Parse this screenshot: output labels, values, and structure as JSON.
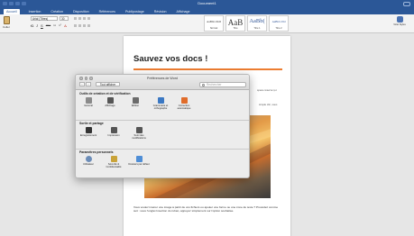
{
  "window": {
    "title": "Document1"
  },
  "ribbon_tabs": [
    "Accueil",
    "Insertion",
    "Création",
    "Disposition",
    "Références",
    "Publipostage",
    "Révision",
    "Affichage"
  ],
  "ribbon": {
    "paste_label": "Coller",
    "font_name": "Arial (Titres)",
    "font_size": "30",
    "format_buttons": [
      "G",
      "I",
      "S",
      "abc",
      "x₂",
      "x²",
      "A"
    ],
    "styles": [
      {
        "sample": "AaBbCcDdI",
        "name": "Normal"
      },
      {
        "sample": "AaB",
        "name": "Titre"
      },
      {
        "sample": "AaBb(",
        "name": "Titre 1"
      },
      {
        "sample": "AaBbCcDd",
        "name": "Titre 2"
      }
    ],
    "styles_pane_label": "Volet Styles"
  },
  "document": {
    "heading": "Sauvez vos docs !",
    "snippet_1": "space réservé (et",
    "snippet_2": "simple clic, sous",
    "paragraph": "Vous voulez insérer une image à partir de vos fichiers ou ajouter une forme ou une zone de texte ? Procédez comme suit : sous l'onglet Insertion du ruban, appuyez simplement sur l'option souhaitée."
  },
  "prefs_dialog": {
    "title": "Préférences de Word",
    "show_all": "Tout afficher",
    "search_placeholder": "Rechercher",
    "sections": [
      {
        "title": "Outils de création et de vérification",
        "items": [
          {
            "label": "Général",
            "icon": "general-icon",
            "color": "#8a8a8a"
          },
          {
            "label": "Affichage",
            "icon": "view-icon",
            "color": "#555555"
          },
          {
            "label": "Édition",
            "icon": "edit-icon",
            "color": "#6b6b6b"
          },
          {
            "label": "Grammaire et orthographe",
            "icon": "spelling-icon",
            "color": "#3b78c3"
          },
          {
            "label": "Correction automatique",
            "icon": "autocorrect-icon",
            "color": "#e06c2a"
          }
        ]
      },
      {
        "title": "Sortie et partage",
        "items": [
          {
            "label": "Enregistrement",
            "icon": "save-icon",
            "color": "#333333"
          },
          {
            "label": "Impression",
            "icon": "print-icon",
            "color": "#555555"
          },
          {
            "label": "Suivi des modifications",
            "icon": "track-changes-icon",
            "color": "#555555"
          }
        ]
      },
      {
        "title": "Paramètres personnels",
        "items": [
          {
            "label": "Utilisateur",
            "icon": "user-icon",
            "color": "#6c8db8"
          },
          {
            "label": "Sécurité & Confidentialité",
            "icon": "lock-icon",
            "color": "#c9a339"
          },
          {
            "label": "Dossiers par défaut",
            "icon": "folder-icon",
            "color": "#4f8ed6"
          }
        ]
      }
    ]
  }
}
